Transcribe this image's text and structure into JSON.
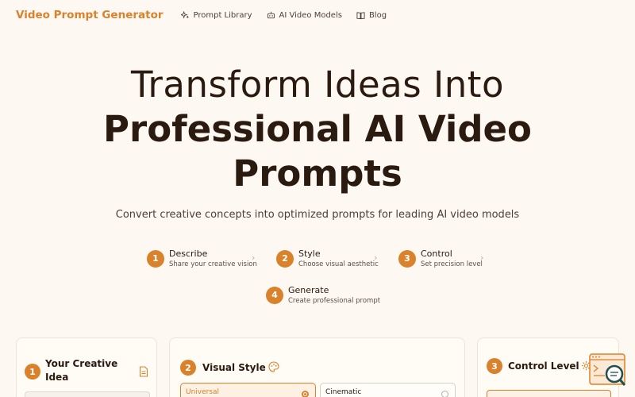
{
  "header": {
    "brand": "Video Prompt Generator",
    "nav": [
      {
        "label": "Prompt Library",
        "icon": "sparkles-icon"
      },
      {
        "label": "AI Video Models",
        "icon": "robot-icon"
      },
      {
        "label": "Blog",
        "icon": "book-icon"
      }
    ]
  },
  "hero": {
    "line1": "Transform Ideas Into",
    "line2a": "Professional AI Video",
    "line2b": "Prompts",
    "subtitle": "Convert creative concepts into optimized prompts for leading AI video models"
  },
  "steps": [
    {
      "num": "1",
      "title": "Describe",
      "desc": "Share your creative vision"
    },
    {
      "num": "2",
      "title": "Style",
      "desc": "Choose visual aesthetic"
    },
    {
      "num": "3",
      "title": "Control",
      "desc": "Set precision level"
    },
    {
      "num": "4",
      "title": "Generate",
      "desc": "Create professional prompt"
    }
  ],
  "cards": {
    "idea": {
      "num": "1",
      "title_a": "Your Creative",
      "title_b": "Idea",
      "icon": "document-icon"
    },
    "style": {
      "num": "2",
      "title": "Visual Style",
      "icon": "palette-icon",
      "options": [
        {
          "label": "Universal",
          "selected": true
        },
        {
          "label": "Cinematic",
          "selected": false
        }
      ]
    },
    "control": {
      "num": "3",
      "title": "Control Level",
      "icon": "gear-icon"
    }
  },
  "colors": {
    "accent": "#d9822b",
    "background": "#fdf8f2",
    "text": "#2a1a10"
  }
}
